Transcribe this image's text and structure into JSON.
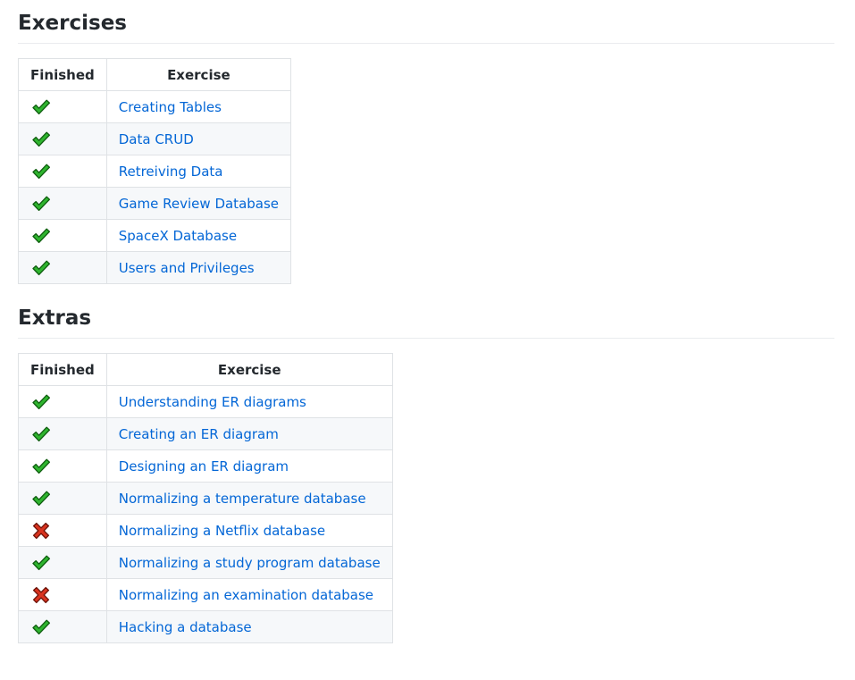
{
  "exercises": {
    "title": "Exercises",
    "headers": {
      "finished": "Finished",
      "exercise": "Exercise"
    },
    "rows": [
      {
        "finished": true,
        "status_icon": "check-icon",
        "label": "Creating Tables"
      },
      {
        "finished": true,
        "status_icon": "check-icon",
        "label": "Data CRUD"
      },
      {
        "finished": true,
        "status_icon": "check-icon",
        "label": "Retreiving Data"
      },
      {
        "finished": true,
        "status_icon": "check-icon",
        "label": "Game Review Database"
      },
      {
        "finished": true,
        "status_icon": "check-icon",
        "label": "SpaceX Database"
      },
      {
        "finished": true,
        "status_icon": "check-icon",
        "label": "Users and Privileges"
      }
    ]
  },
  "extras": {
    "title": "Extras",
    "headers": {
      "finished": "Finished",
      "exercise": "Exercise"
    },
    "rows": [
      {
        "finished": true,
        "status_icon": "check-icon",
        "label": "Understanding ER diagrams"
      },
      {
        "finished": true,
        "status_icon": "check-icon",
        "label": "Creating an ER diagram"
      },
      {
        "finished": true,
        "status_icon": "check-icon",
        "label": "Designing an ER diagram"
      },
      {
        "finished": true,
        "status_icon": "check-icon",
        "label": "Normalizing a temperature database"
      },
      {
        "finished": false,
        "status_icon": "cross-icon",
        "label": "Normalizing a Netflix database"
      },
      {
        "finished": true,
        "status_icon": "check-icon",
        "label": "Normalizing a study program database"
      },
      {
        "finished": false,
        "status_icon": "cross-icon",
        "label": "Normalizing an examination database"
      },
      {
        "finished": true,
        "status_icon": "check-icon",
        "label": "Hacking a database"
      }
    ]
  },
  "colors": {
    "link": "#0366d6",
    "check": "#2fb52f",
    "cross": "#d9331f",
    "row_alt_bg": "#f6f8fa",
    "border": "#dfe2e5"
  }
}
